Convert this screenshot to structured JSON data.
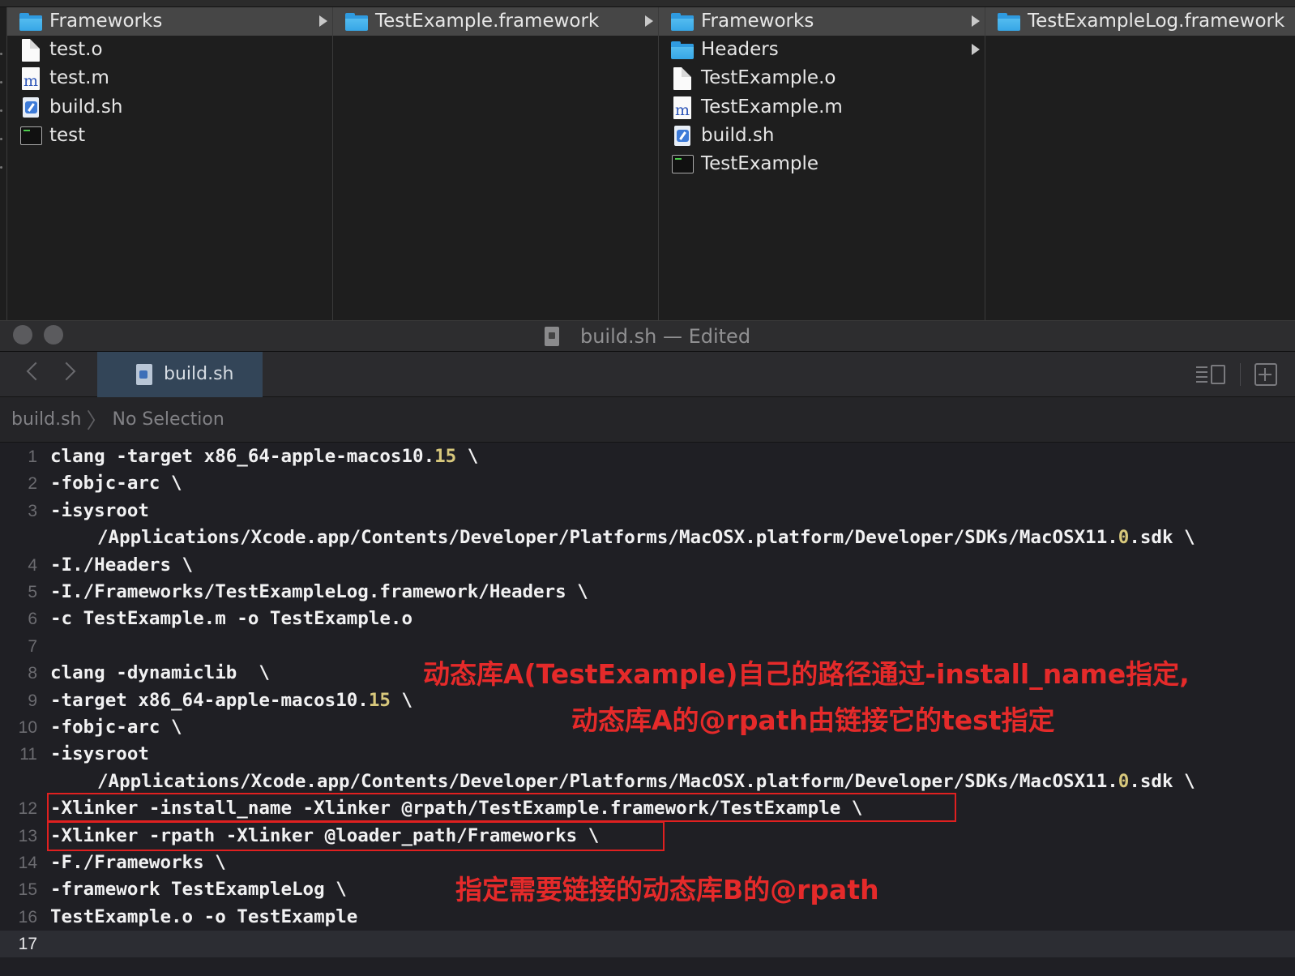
{
  "finder": {
    "columns": [
      {
        "items": [
          {
            "label": "Frameworks",
            "icon": "folder-icon",
            "selected": true,
            "has_children": true
          },
          {
            "label": "test.o",
            "icon": "document-icon"
          },
          {
            "label": "test.m",
            "icon": "objc-file-icon"
          },
          {
            "label": "build.sh",
            "icon": "shell-script-icon"
          },
          {
            "label": "test",
            "icon": "executable-icon"
          }
        ]
      },
      {
        "items": [
          {
            "label": "TestExample.framework",
            "icon": "folder-icon",
            "selected": true,
            "has_children": true
          }
        ]
      },
      {
        "items": [
          {
            "label": "Frameworks",
            "icon": "folder-icon",
            "selected": true,
            "has_children": true
          },
          {
            "label": "Headers",
            "icon": "folder-icon",
            "has_children": true
          },
          {
            "label": "TestExample.o",
            "icon": "document-icon"
          },
          {
            "label": "TestExample.m",
            "icon": "objc-file-icon"
          },
          {
            "label": "build.sh",
            "icon": "shell-script-icon"
          },
          {
            "label": "TestExample",
            "icon": "executable-icon"
          }
        ]
      },
      {
        "items": [
          {
            "label": "TestExampleLog.framework",
            "icon": "folder-icon",
            "selected": true
          }
        ]
      }
    ]
  },
  "window": {
    "title": "build.sh — Edited"
  },
  "editor": {
    "tab_label": "build.sh",
    "jumpbar": {
      "file": "build.sh",
      "selection": "No Selection"
    },
    "current_line": 17,
    "lines": [
      {
        "n": "1",
        "parts": [
          {
            "t": "clang -target x86_64-apple-macos10."
          },
          {
            "t": "15",
            "num": true
          },
          {
            "t": " \\"
          }
        ]
      },
      {
        "n": "2",
        "parts": [
          {
            "t": "-fobjc-arc \\"
          }
        ]
      },
      {
        "n": "3",
        "parts": [
          {
            "t": "-isysroot"
          }
        ]
      },
      {
        "n": "",
        "indent": true,
        "parts": [
          {
            "t": "/Applications/Xcode.app/Contents/Developer/Platforms/MacOSX.platform/Developer/SDKs/MacOSX11."
          },
          {
            "t": "0",
            "num": true
          },
          {
            "t": ".sdk \\"
          }
        ]
      },
      {
        "n": "4",
        "parts": [
          {
            "t": "-I./Headers \\"
          }
        ]
      },
      {
        "n": "5",
        "parts": [
          {
            "t": "-I./Frameworks/TestExampleLog.framework/Headers \\"
          }
        ]
      },
      {
        "n": "6",
        "parts": [
          {
            "t": "-c TestExample.m -o TestExample.o"
          }
        ]
      },
      {
        "n": "7",
        "parts": [
          {
            "t": ""
          }
        ]
      },
      {
        "n": "8",
        "parts": [
          {
            "t": "clang -dynamiclib  \\"
          }
        ]
      },
      {
        "n": "9",
        "parts": [
          {
            "t": "-target x86_64-apple-macos10."
          },
          {
            "t": "15",
            "num": true
          },
          {
            "t": " \\"
          }
        ]
      },
      {
        "n": "10",
        "parts": [
          {
            "t": "-fobjc-arc \\"
          }
        ]
      },
      {
        "n": "11",
        "parts": [
          {
            "t": "-isysroot"
          }
        ]
      },
      {
        "n": "",
        "indent": true,
        "parts": [
          {
            "t": "/Applications/Xcode.app/Contents/Developer/Platforms/MacOSX.platform/Developer/SDKs/MacOSX11."
          },
          {
            "t": "0",
            "num": true
          },
          {
            "t": ".sdk \\"
          }
        ]
      },
      {
        "n": "12",
        "parts": [
          {
            "t": "-Xlinker -install_name -Xlinker @rpath/TestExample.framework/TestExample \\"
          }
        ]
      },
      {
        "n": "13",
        "parts": [
          {
            "t": "-Xlinker -rpath -Xlinker @loader_path/Frameworks \\"
          }
        ]
      },
      {
        "n": "14",
        "parts": [
          {
            "t": "-F./Frameworks \\"
          }
        ]
      },
      {
        "n": "15",
        "parts": [
          {
            "t": "-framework TestExampleLog \\"
          }
        ]
      },
      {
        "n": "16",
        "parts": [
          {
            "t": "TestExample.o -o TestExample"
          }
        ]
      },
      {
        "n": "17",
        "parts": [
          {
            "t": ""
          }
        ]
      }
    ]
  },
  "annotations": {
    "note_install_name_line1": "动态库A(TestExample)自己的路径通过-install_name指定,",
    "note_install_name_line2": "动态库A的@rpath由链接它的test指定",
    "note_rpath": "指定需要链接的动态库B的@rpath",
    "color": "#e52a2a"
  }
}
